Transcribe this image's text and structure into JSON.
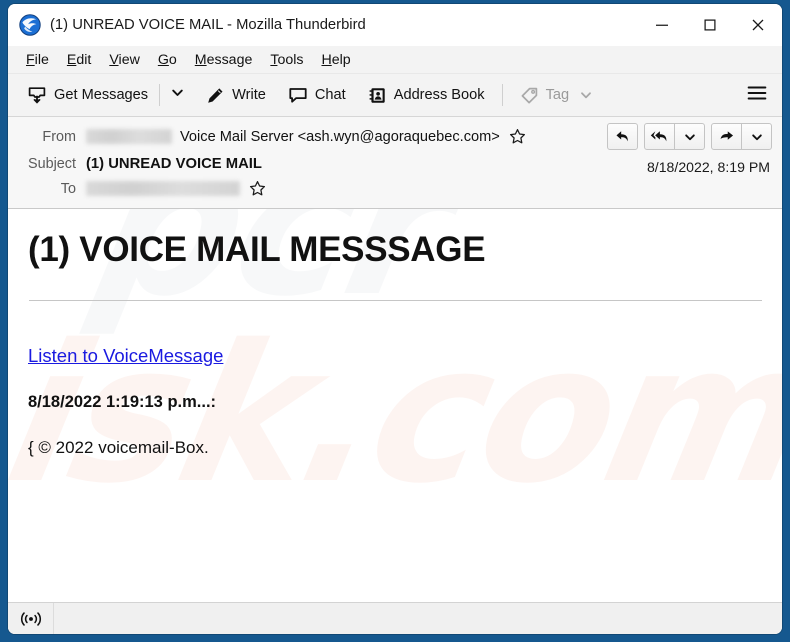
{
  "window": {
    "title": "(1) UNREAD VOICE MAIL - Mozilla Thunderbird",
    "app_icon": "thunderbird-logo-icon",
    "minimize_label": "—",
    "maximize_label": "☐",
    "close_label": "✕",
    "border_color": "#15588f"
  },
  "menubar": {
    "items": [
      {
        "label": "File",
        "accel": "F"
      },
      {
        "label": "Edit",
        "accel": "E"
      },
      {
        "label": "View",
        "accel": "V"
      },
      {
        "label": "Go",
        "accel": "G"
      },
      {
        "label": "Message",
        "accel": "M"
      },
      {
        "label": "Tools",
        "accel": "T"
      },
      {
        "label": "Help",
        "accel": "H"
      }
    ]
  },
  "toolbar": {
    "get_messages_label": "Get Messages",
    "get_messages_icon": "inbox-download-icon",
    "get_messages_caret_icon": "chevron-down-icon",
    "write_label": "Write",
    "write_icon": "pencil-icon",
    "chat_label": "Chat",
    "chat_icon": "speech-bubble-icon",
    "address_book_label": "Address Book",
    "address_book_icon": "address-book-icon",
    "tag_label": "Tag",
    "tag_icon": "tag-icon",
    "tag_caret_icon": "chevron-down-icon",
    "tag_disabled": true,
    "menu_icon": "hamburger-menu-icon"
  },
  "message_header": {
    "from_label": "From",
    "from_redacted": true,
    "from_name": "Voice Mail Server <ash.wyn@agoraquebec.com>",
    "from_star_icon": "star-outline-icon",
    "subject_label": "Subject",
    "subject_value": "(1) UNREAD VOICE MAIL",
    "to_label": "To",
    "to_redacted": true,
    "to_star_icon": "star-outline-icon",
    "date": "8/18/2022, 8:19 PM",
    "actions": [
      {
        "name": "reply-button",
        "icon": "reply-arrow-icon"
      },
      {
        "name": "reply-all-button",
        "icon": "reply-all-arrow-icon"
      },
      {
        "name": "reply-all-dropdown",
        "icon": "chevron-down-icon"
      },
      {
        "name": "forward-button",
        "icon": "forward-arrow-icon"
      },
      {
        "name": "forward-dropdown",
        "icon": "chevron-down-icon"
      }
    ]
  },
  "message_body": {
    "heading": "(1) VOICE MAIL MESSSAGE",
    "link_text": "Listen to VoiceMessage",
    "timestamp_text": "8/18/2022 1:19:13 p.m...:",
    "footer_text": "{ © 2022 voicemail-Box.",
    "link_color": "#1a1ae0"
  },
  "statusbar": {
    "connection_icon": "broadcast-signal-icon",
    "status_text": ""
  },
  "watermark": {
    "line_a": "pcr",
    "line_b": "isk.com"
  }
}
